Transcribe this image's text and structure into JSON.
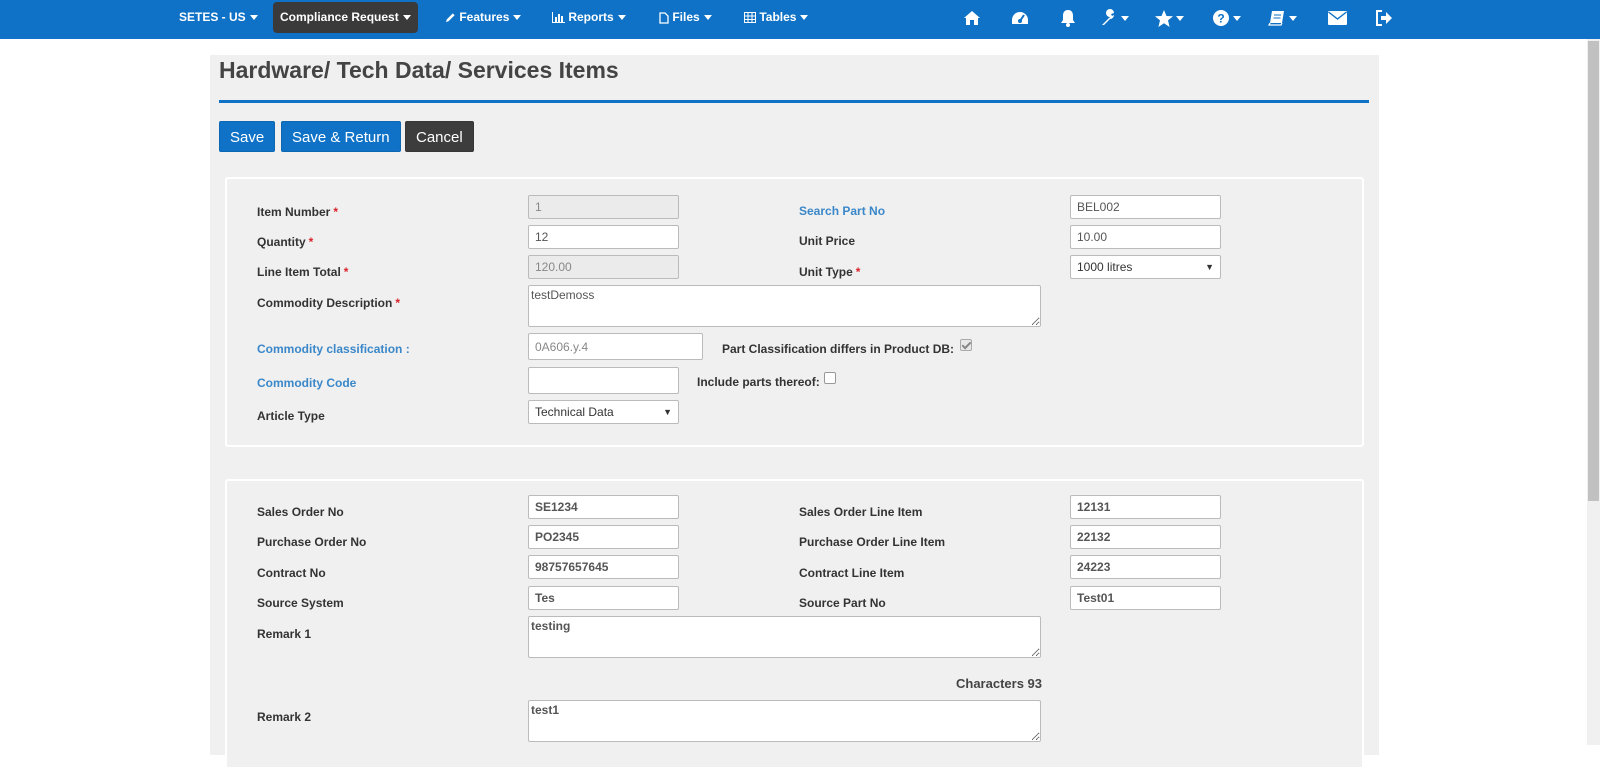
{
  "nav": {
    "menus": [
      {
        "label": "SETES - US"
      },
      {
        "label": "Compliance Request"
      },
      {
        "label": "Features",
        "icon": "pencil-icon"
      },
      {
        "label": "Reports",
        "icon": "bar-chart-icon"
      },
      {
        "label": "Files",
        "icon": "file-icon"
      },
      {
        "label": "Tables",
        "icon": "table-icon"
      }
    ],
    "icons": [
      "home-icon",
      "dashboard-icon",
      "bell-icon",
      "wrench-icon",
      "star-icon",
      "question-icon",
      "book-icon",
      "envelope-icon",
      "logout-icon"
    ],
    "accent": "#0f72c6"
  },
  "page": {
    "title": "Hardware/ Tech Data/ Services Items"
  },
  "actions": {
    "save": "Save",
    "save_return": "Save & Return",
    "cancel": "Cancel"
  },
  "item": {
    "item_number_label": "Item Number",
    "item_number": "1",
    "quantity_label": "Quantity",
    "quantity": "12",
    "line_total_label": "Line Item Total",
    "line_total": "120.00",
    "commodity_desc_label": "Commodity Description",
    "commodity_desc": "testDemoss",
    "commodity_class_label": "Commodity classification :",
    "commodity_class": "0A606.y.4",
    "part_class_differs_label": "Part Classification differs in Product DB:",
    "commodity_code_label": "Commodity Code",
    "commodity_code": "",
    "include_parts_label": "Include parts thereof:",
    "article_type_label": "Article Type",
    "article_type": "Technical Data",
    "search_part_label": "Search Part No",
    "search_part": "BEL002",
    "unit_price_label": "Unit Price",
    "unit_price": "10.00",
    "unit_type_label": "Unit Type",
    "unit_type": "1000 litres",
    "part_class_differs_checked": true,
    "include_parts_checked": false
  },
  "order": {
    "sales_order_label": "Sales Order No",
    "sales_order": "SE1234",
    "purchase_order_label": "Purchase Order No",
    "purchase_order": "PO2345",
    "contract_label": "Contract No",
    "contract": "98757657645",
    "source_system_label": "Source System",
    "source_system": "Tes",
    "remark1_label": "Remark 1",
    "remark1": "testing",
    "characters_label": "Characters 93",
    "remark2_label": "Remark 2",
    "remark2": "test1",
    "sales_line_label": "Sales Order Line Item",
    "sales_line": "12131",
    "purchase_line_label": "Purchase Order Line Item",
    "purchase_line": "22132",
    "contract_line_label": "Contract Line Item",
    "contract_line": "24223",
    "source_part_label": "Source Part No",
    "source_part": "Test01"
  }
}
